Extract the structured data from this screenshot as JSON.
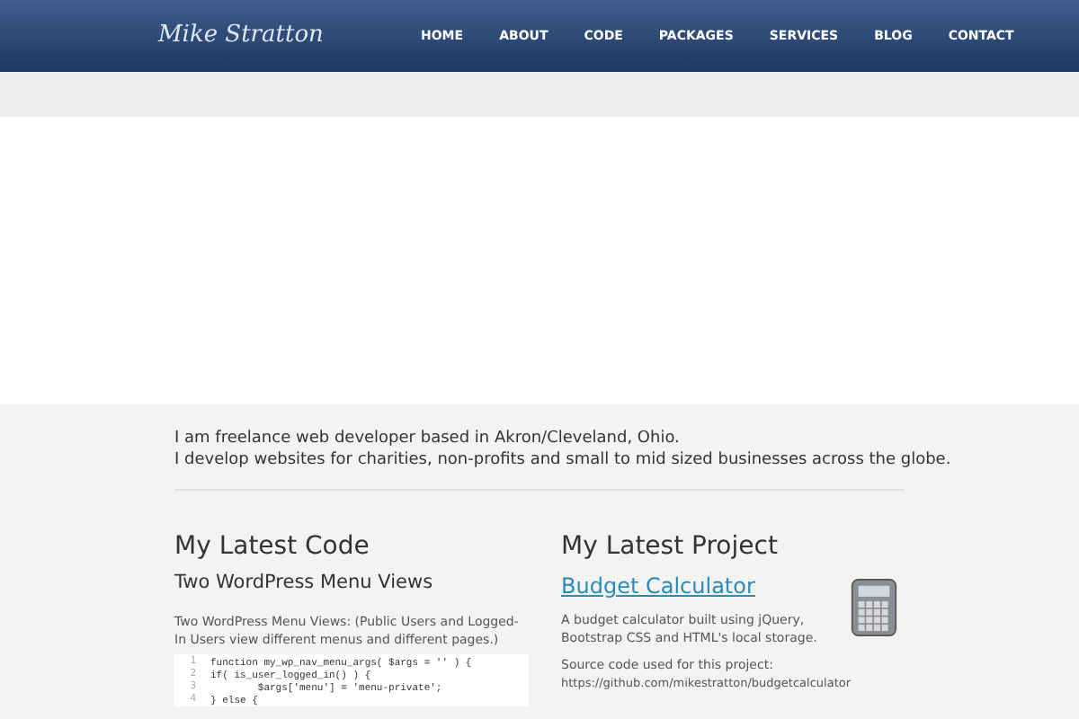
{
  "header": {
    "logo": "Mike Stratton",
    "nav": [
      {
        "label": "HOME"
      },
      {
        "label": "ABOUT"
      },
      {
        "label": "CODE"
      },
      {
        "label": "PACKAGES"
      },
      {
        "label": "SERVICES"
      },
      {
        "label": "BLOG"
      },
      {
        "label": "CONTACT"
      }
    ]
  },
  "intro": [
    "I am freelance web developer based in Akron/Cleveland, Ohio.",
    "I develop websites for charities, non-profits and small to mid sized businesses across the globe."
  ],
  "latest_code": {
    "heading": "My Latest Code",
    "title": "Two WordPress Menu Views",
    "description": "Two WordPress Menu Views: (Public Users and Logged-In Users view different menus and different pages.)",
    "code": [
      {
        "number": "1",
        "text": "function my_wp_nav_menu_args( $args = '' ) {"
      },
      {
        "number": "2",
        "text": "if( is_user_logged_in() ) {"
      },
      {
        "number": "3",
        "text": "        $args['menu'] = 'menu-private';"
      },
      {
        "number": "4",
        "text": "} else {"
      }
    ]
  },
  "latest_project": {
    "heading": "My Latest Project",
    "title": "Budget Calculator",
    "description": "A budget calculator built using jQuery, Bootstrap CSS and HTML's local storage.",
    "source_label": "Source code used for this project:",
    "source_url": "https://github.com/mikestratton/budgetcalculator"
  }
}
